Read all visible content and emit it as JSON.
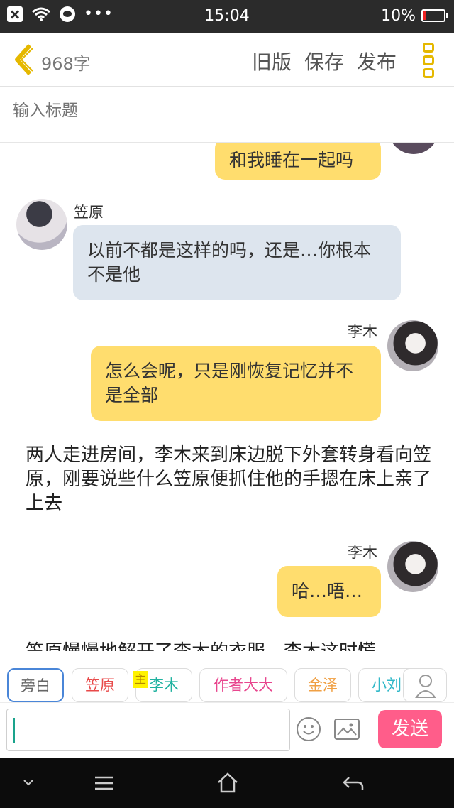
{
  "status_bar": {
    "time": "15:04",
    "battery": "10%",
    "more": "•••"
  },
  "header": {
    "word_count": "968字",
    "old_version_label": "旧版",
    "save_label": "保存",
    "publish_label": "发布"
  },
  "title": {
    "placeholder": "输入标题"
  },
  "messages": [
    {
      "speaker": "",
      "text": "和我睡在一起吗"
    },
    {
      "speaker": "笠原",
      "text": "以前不都是这样的吗，还是…你根本不是他"
    },
    {
      "speaker": "李木",
      "text": "怎么会呢，只是刚恢复记忆并不是全部"
    },
    {
      "speaker": "",
      "text": "两人走进房间，李木来到床边脱下外套转身看向笠原，刚要说些什么笠原便抓住他的手摁在床上亲了上去"
    },
    {
      "speaker": "李木",
      "text": "哈…唔…"
    },
    {
      "speaker": "",
      "text": "笠原慢慢地解开了李木的衣服，李木这时慌"
    }
  ],
  "characters": {
    "narrator": "旁白",
    "kasahara": "笠原",
    "main_tag": "主",
    "limu": "李木",
    "author": "作者大大",
    "jinze": "金泽",
    "xiaoliu": "小刘"
  },
  "composer": {
    "send_label": "发送"
  },
  "colors": {
    "accent": "#ffdd6e",
    "send": "#ff5d8a",
    "back_arrow": "#e5b800",
    "other_bubble": "#dde5ee"
  }
}
